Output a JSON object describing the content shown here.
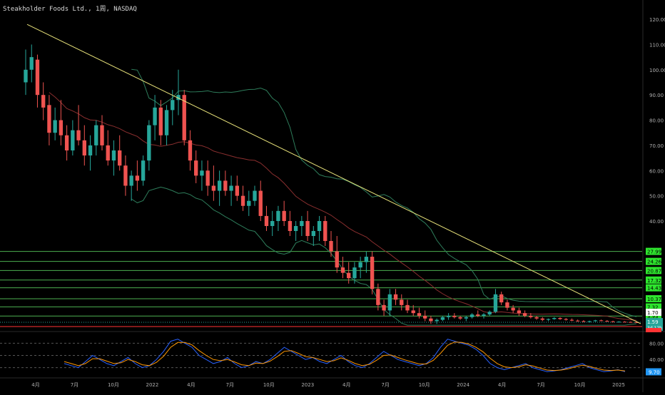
{
  "header": {
    "title": "Steakholder Foods Ltd., 1周, NASDAQ"
  },
  "colors": {
    "background": "#000000",
    "up": "#26a69a",
    "down": "#ef5350",
    "trendline": "#e8e27a",
    "support": "#4caf50",
    "bollinger": "#2e7d5b",
    "ma": "#8b2f2f",
    "osc_k": "#2962ff",
    "osc_d": "#ff9800",
    "red_line": "#ff3333"
  },
  "chart_data": [
    {
      "type": "candlestick",
      "title": "Steakholder Foods Ltd., 1周, NASDAQ",
      "ylim": [
        0,
        125
      ],
      "y_ticks": [
        "120.00",
        "110.00",
        "100.00",
        "90.00",
        "80.00",
        "70.00",
        "60.00",
        "50.00",
        "40.00"
      ],
      "y_tick_values": [
        120,
        110,
        100,
        90,
        80,
        70,
        60,
        50,
        40
      ],
      "x_labels": [
        "4月",
        "7月",
        "10月",
        "2022",
        "4月",
        "7月",
        "10月",
        "2023",
        "4月",
        "7月",
        "10月",
        "2024",
        "4月",
        "7月",
        "10月",
        "2025"
      ],
      "support_levels": [
        27.99,
        24.26,
        20.87,
        17.32,
        14.43,
        10.37,
        7.32,
        3.93
      ],
      "current_price": "1.59",
      "countdown": "3d 12h",
      "reference_price": "1.70",
      "trendline": {
        "from": [
          0,
          118
        ],
        "to": [
          205,
          0
        ]
      },
      "candles": [
        [
          95,
          108,
          90,
          100
        ],
        [
          100,
          110,
          95,
          105
        ],
        [
          104,
          106,
          85,
          90
        ],
        [
          90,
          95,
          80,
          85
        ],
        [
          86,
          90,
          70,
          75
        ],
        [
          75,
          85,
          72,
          80
        ],
        [
          80,
          88,
          70,
          74
        ],
        [
          74,
          78,
          64,
          68
        ],
        [
          68,
          80,
          66,
          76
        ],
        [
          76,
          86,
          70,
          72
        ],
        [
          72,
          78,
          62,
          66
        ],
        [
          66,
          74,
          60,
          70
        ],
        [
          70,
          80,
          66,
          78
        ],
        [
          78,
          82,
          68,
          70
        ],
        [
          70,
          76,
          62,
          64
        ],
        [
          64,
          72,
          58,
          68
        ],
        [
          68,
          74,
          60,
          62
        ],
        [
          62,
          66,
          50,
          54
        ],
        [
          54,
          60,
          48,
          58
        ],
        [
          58,
          64,
          52,
          56
        ],
        [
          56,
          66,
          54,
          64
        ],
        [
          64,
          80,
          60,
          78
        ],
        [
          78,
          90,
          72,
          85
        ],
        [
          85,
          88,
          70,
          74
        ],
        [
          74,
          86,
          70,
          84
        ],
        [
          84,
          92,
          78,
          88
        ],
        [
          88,
          100,
          82,
          90
        ],
        [
          90,
          92,
          70,
          72
        ],
        [
          72,
          76,
          60,
          64
        ],
        [
          64,
          68,
          55,
          58
        ],
        [
          58,
          64,
          52,
          60
        ],
        [
          60,
          64,
          50,
          54
        ],
        [
          54,
          62,
          48,
          52
        ],
        [
          52,
          60,
          46,
          56
        ],
        [
          56,
          60,
          50,
          52
        ],
        [
          52,
          58,
          46,
          54
        ],
        [
          54,
          58,
          48,
          50
        ],
        [
          50,
          54,
          44,
          46
        ],
        [
          46,
          52,
          42,
          48
        ],
        [
          48,
          54,
          46,
          52
        ],
        [
          52,
          56,
          40,
          42
        ],
        [
          42,
          46,
          36,
          38
        ],
        [
          38,
          44,
          34,
          40
        ],
        [
          40,
          46,
          36,
          44
        ],
        [
          44,
          48,
          38,
          40
        ],
        [
          40,
          44,
          34,
          36
        ],
        [
          36,
          40,
          32,
          38
        ],
        [
          38,
          42,
          34,
          40
        ],
        [
          40,
          44,
          32,
          34
        ],
        [
          34,
          38,
          30,
          36
        ],
        [
          36,
          42,
          32,
          40
        ],
        [
          40,
          42,
          30,
          32
        ],
        [
          32,
          36,
          26,
          28
        ],
        [
          28,
          34,
          20,
          22
        ],
        [
          22,
          26,
          18,
          20
        ],
        [
          20,
          24,
          16,
          18
        ],
        [
          18,
          24,
          16,
          22
        ],
        [
          22,
          26,
          18,
          24
        ],
        [
          24,
          28,
          20,
          26
        ],
        [
          26,
          28,
          12,
          14
        ],
        [
          14,
          16,
          6,
          8
        ],
        [
          8,
          10,
          4,
          6
        ],
        [
          6,
          14,
          4,
          12
        ],
        [
          12,
          14,
          8,
          10
        ],
        [
          10,
          12,
          6,
          8
        ],
        [
          8,
          10,
          5,
          6
        ],
        [
          6,
          8,
          4,
          5
        ],
        [
          5,
          7,
          3,
          4
        ],
        [
          4,
          6,
          2,
          3
        ],
        [
          3,
          4,
          1,
          2
        ],
        [
          2,
          3,
          1,
          2.5
        ],
        [
          2.5,
          4,
          2,
          3.5
        ],
        [
          3.5,
          5,
          2.5,
          4
        ],
        [
          4,
          5,
          3,
          3.5
        ],
        [
          3.5,
          4,
          2.5,
          3
        ],
        [
          3,
          4,
          2,
          3.5
        ],
        [
          3.5,
          5,
          3,
          4.5
        ],
        [
          4.5,
          6,
          3.5,
          4
        ],
        [
          4,
          5,
          3,
          4.5
        ],
        [
          4.5,
          6,
          4,
          5.5
        ],
        [
          5.5,
          14,
          5,
          12
        ],
        [
          12,
          13,
          8,
          9
        ],
        [
          9,
          10,
          6,
          7
        ],
        [
          7,
          8,
          5,
          6
        ],
        [
          6,
          7,
          4,
          5
        ],
        [
          5,
          6,
          3.5,
          4
        ],
        [
          4,
          5,
          3,
          3.5
        ],
        [
          3.5,
          4,
          2.5,
          3
        ],
        [
          3,
          3.5,
          2,
          2.5
        ],
        [
          2.5,
          3,
          2,
          2.8
        ],
        [
          2.8,
          3.5,
          2.5,
          3.2
        ],
        [
          3.2,
          3.5,
          2.5,
          2.8
        ],
        [
          2.8,
          3.2,
          2.2,
          2.5
        ],
        [
          2.5,
          3,
          2,
          2.2
        ],
        [
          2.2,
          2.6,
          1.8,
          2
        ],
        [
          2,
          2.4,
          1.6,
          1.8
        ],
        [
          1.8,
          2.2,
          1.5,
          2
        ],
        [
          2,
          2.5,
          1.8,
          2.3
        ],
        [
          2.3,
          2.6,
          2,
          2.1
        ],
        [
          2.1,
          2.4,
          1.8,
          1.9
        ],
        [
          1.9,
          2.2,
          1.6,
          1.7
        ],
        [
          1.7,
          2,
          1.5,
          1.8
        ],
        [
          1.8,
          2,
          1.6,
          1.7
        ],
        [
          1.7,
          1.9,
          1.5,
          1.6
        ],
        [
          1.6,
          1.8,
          1.4,
          1.59
        ]
      ]
    },
    {
      "type": "line",
      "title": "",
      "ylim": [
        0,
        100
      ],
      "y_ticks": [
        "80.00",
        "40.00"
      ],
      "y_tick_values": [
        80,
        40
      ],
      "current_value": "9.70",
      "dashed_levels": [
        80,
        50,
        20
      ],
      "series": [
        {
          "values": [
            30,
            25,
            20,
            35,
            50,
            40,
            30,
            25,
            35,
            45,
            30,
            20,
            25,
            40,
            60,
            85,
            90,
            80,
            70,
            50,
            40,
            30,
            35,
            45,
            30,
            20,
            25,
            35,
            30,
            40,
            55,
            70,
            60,
            50,
            40,
            45,
            35,
            30,
            40,
            50,
            35,
            25,
            20,
            30,
            45,
            60,
            50,
            40,
            35,
            30,
            25,
            30,
            45,
            70,
            90,
            85,
            80,
            75,
            65,
            50,
            30,
            20,
            15,
            20,
            25,
            30,
            20,
            15,
            10,
            12,
            15,
            20,
            25,
            30,
            20,
            15,
            10,
            12,
            15,
            10
          ]
        },
        {
          "values": [
            35,
            30,
            25,
            30,
            42,
            42,
            36,
            30,
            32,
            40,
            35,
            27,
            25,
            33,
            48,
            70,
            82,
            82,
            76,
            62,
            50,
            40,
            37,
            40,
            34,
            27,
            25,
            31,
            30,
            36,
            47,
            60,
            62,
            55,
            47,
            45,
            40,
            35,
            37,
            44,
            38,
            30,
            25,
            28,
            38,
            50,
            51,
            45,
            39,
            34,
            29,
            29,
            38,
            55,
            75,
            83,
            82,
            78,
            70,
            59,
            43,
            30,
            22,
            20,
            22,
            27,
            24,
            19,
            14,
            13,
            14,
            17,
            22,
            26,
            23,
            18,
            14,
            13,
            14,
            12
          ]
        }
      ]
    }
  ]
}
